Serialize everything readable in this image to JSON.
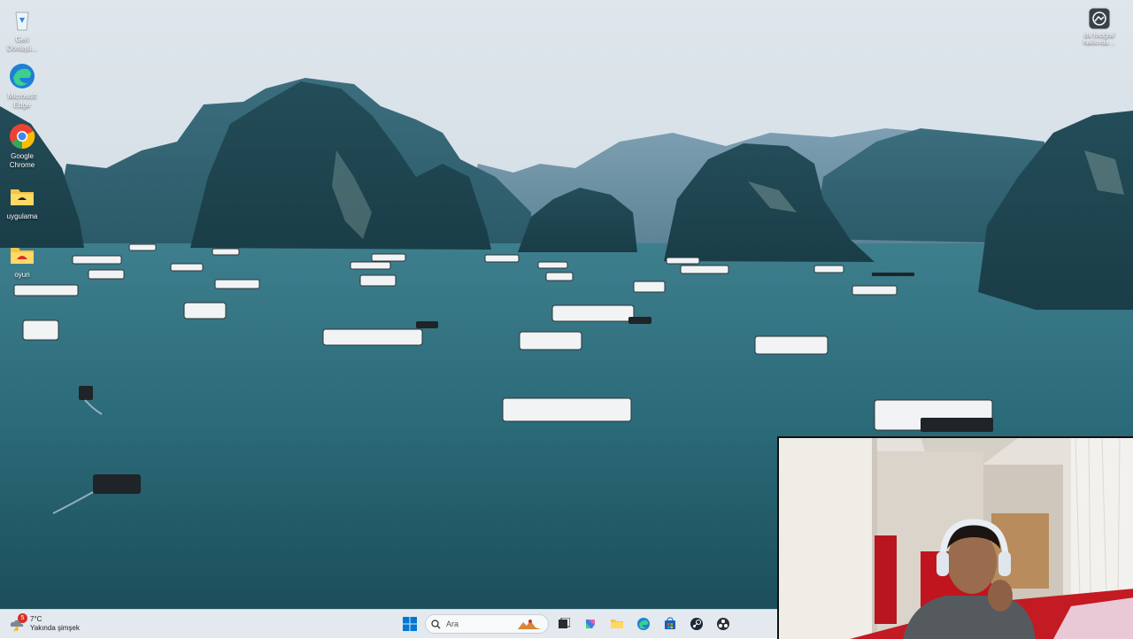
{
  "desktop": {
    "icons": [
      {
        "label": "Geri Dönüşü...",
        "icon": "recycle-bin-icon"
      },
      {
        "label": "Microsoft Edge",
        "icon": "edge-icon"
      },
      {
        "label": "Google Chrome",
        "icon": "chrome-icon"
      },
      {
        "label": "uygulama",
        "icon": "folder-icon"
      },
      {
        "label": "oyun",
        "icon": "folder-icon"
      }
    ],
    "corner": {
      "label": "Bu fotoğraf hakkında ...",
      "icon": "camera-icon"
    }
  },
  "taskbar": {
    "weather": {
      "temp": "7°C",
      "desc": "Yakında şimşek",
      "badge": "5"
    },
    "search": {
      "placeholder": "Ara"
    },
    "pinned": [
      {
        "name": "start-button",
        "icon": "windows-icon"
      },
      {
        "name": "task-view",
        "icon": "task-view-icon"
      },
      {
        "name": "copilot",
        "icon": "copilot-icon"
      },
      {
        "name": "file-explorer",
        "icon": "folder-icon"
      },
      {
        "name": "edge",
        "icon": "edge-icon"
      },
      {
        "name": "store",
        "icon": "store-icon"
      },
      {
        "name": "steam",
        "icon": "steam-icon"
      },
      {
        "name": "obs",
        "icon": "obs-icon"
      }
    ]
  },
  "colors": {
    "taskbar_bg": "#e3e9ef",
    "windows_blue": "#0078d4"
  }
}
